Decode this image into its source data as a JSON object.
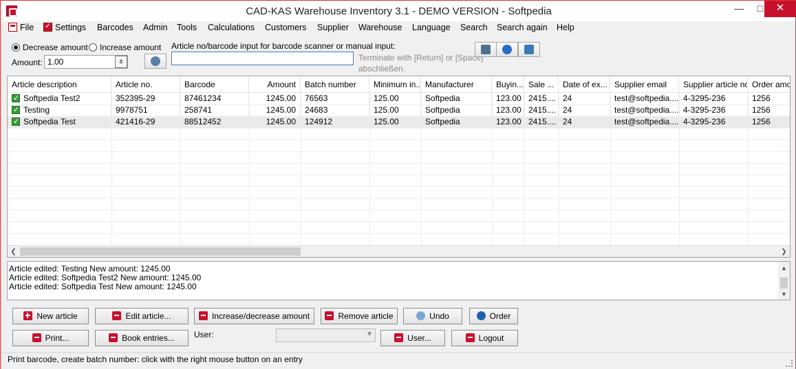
{
  "window": {
    "title": "CAD-KAS Warehouse Inventory 3.1 - DEMO VERSION - Softpedia"
  },
  "menu": [
    {
      "label": "File",
      "icon": "file-icon"
    },
    {
      "label": "Settings",
      "icon": "settings-icon"
    },
    {
      "label": "Barcodes"
    },
    {
      "label": "Admin"
    },
    {
      "label": "Tools"
    },
    {
      "label": "Calculations"
    },
    {
      "label": "Customers"
    },
    {
      "label": "Supplier"
    },
    {
      "label": "Warehouse"
    },
    {
      "label": "Language"
    },
    {
      "label": "Search"
    },
    {
      "label": "Search again"
    },
    {
      "label": "Help"
    }
  ],
  "mode": {
    "decrease_label": "Decrease amount",
    "increase_label": "Increase amount",
    "selected": "decrease"
  },
  "amount": {
    "label": "Amount:",
    "value": "1.00"
  },
  "article_input": {
    "label": "Article no/barcode input for barcode scanner or manual input:",
    "value": "",
    "hint_line1": "Terminate with [Return] or [Space]",
    "hint_line2": "abschließen."
  },
  "grid": {
    "columns": [
      "Article description",
      "Article no.",
      "Barcode",
      "Amount",
      "Batch number",
      "Minimum in...",
      "Manufacturer",
      "Buyin...",
      "Sale ...",
      "Date of ex...",
      "Supplier email",
      "Supplier article no.",
      "Order amou"
    ],
    "rows": [
      [
        "Softpedia Test2",
        "352395-29",
        "87461234",
        "1245.00",
        "76563",
        "125.00",
        "Softpedia",
        "123.00",
        "2415....",
        "24",
        "test@softpedia....",
        "4-3295-236",
        "1256"
      ],
      [
        "Testing",
        "9978751",
        "258741",
        "1245.00",
        "24683",
        "125.00",
        "Softpedia",
        "123.00",
        "2415....",
        "24",
        "test@softpedia....",
        "4-3295-236",
        "1256"
      ],
      [
        "Softpedia Test",
        "421416-29",
        "88512452",
        "1245.00",
        "124912",
        "125.00",
        "Softpedia",
        "123.00",
        "2415....",
        "24",
        "test@softpedia....",
        "4-3295-236",
        "1256"
      ]
    ]
  },
  "log": [
    "Article edited: Testing New amount: 1245.00",
    "Article edited: Softpedia Test2 New amount: 1245.00",
    "Article edited: Softpedia Test New amount: 1245.00"
  ],
  "buttons": {
    "new_article": "New article",
    "edit_article": "Edit article...",
    "increase_decrease": "Increase/decrease amount",
    "remove_article": "Remove article",
    "undo": "Undo",
    "order": "Order",
    "print": "Print...",
    "book_entries": "Book entries...",
    "user_label": "User:",
    "user": "User...",
    "logout": "Logout"
  },
  "status": "Print barcode, create batch number: click with the right mouse button on an entry"
}
